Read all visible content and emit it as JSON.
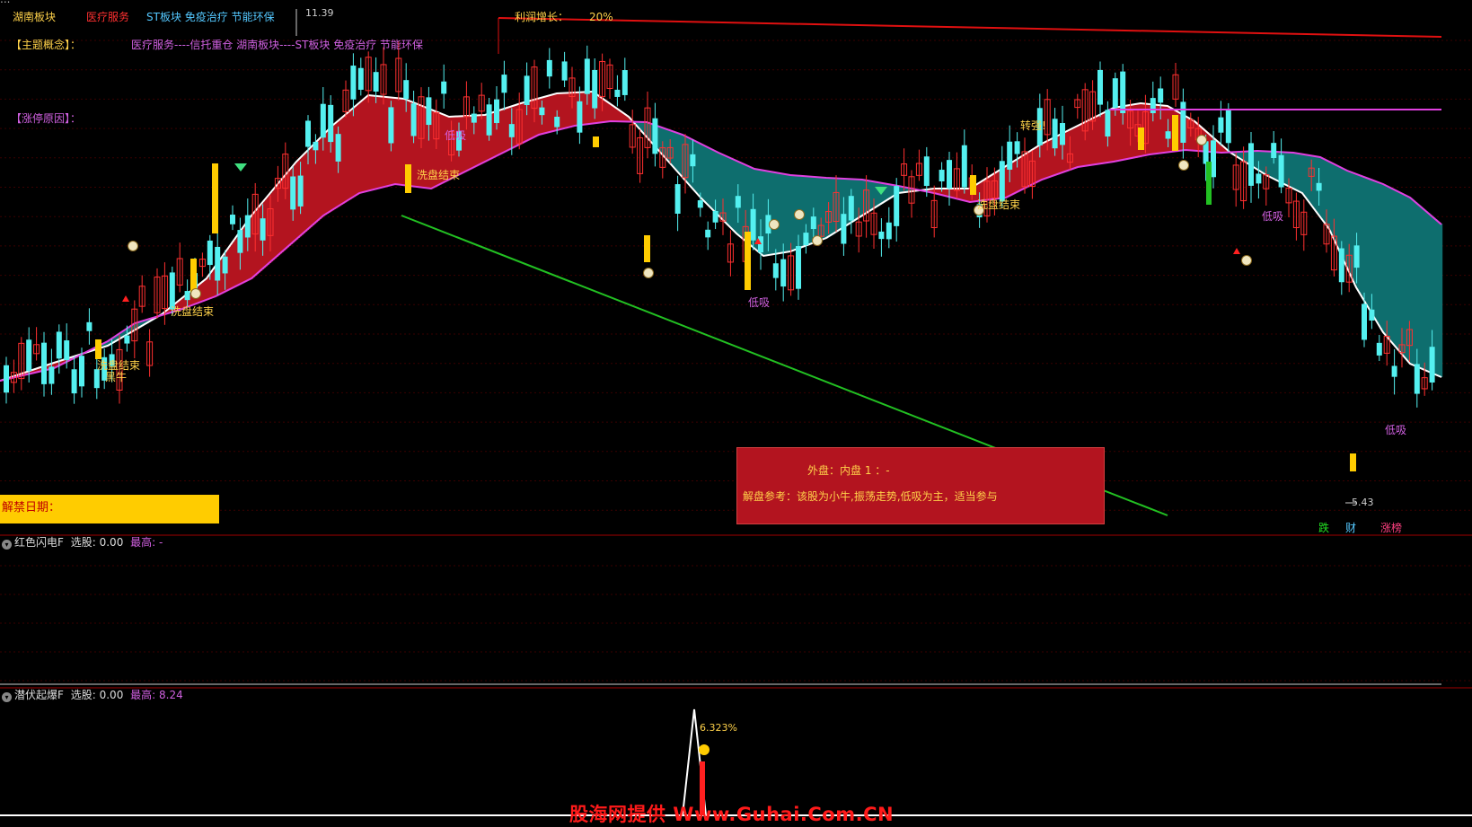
{
  "header": {
    "truncated_line": "...",
    "board": "湖南板块",
    "industry": "医疗服务",
    "concepts": "ST板块 免疫治疗 节能环保",
    "profit_growth_label": "利润增长：",
    "profit_growth_value": "20%",
    "theme_label": "【主题概念】：",
    "theme_value": "医疗服务----信托重仓 湖南板块----ST板块 免疫治疗 节能环保",
    "limit_reason_label": "【涨停原因】："
  },
  "main_chart": {
    "high_mark": "11.39",
    "low_mark": "5.43",
    "unlock_label": "解禁日期：",
    "signals": {
      "wash_end": "洗盘结束",
      "low_buy": "低吸",
      "black_horse": "黑牛",
      "turn_strong": "转强!",
      "wash_end_2": "洗盘结束"
    },
    "info_box": {
      "line1": "外盘：内盘   1  ：-",
      "line2": "解盘参考：该股为小牛,振荡走势,低吸为主，适当参与"
    },
    "tags": [
      "跌",
      "财",
      "涨榜"
    ],
    "colors": {
      "up": "#ff3030",
      "down": "#54f0f0",
      "band_up": "#b3141f",
      "band_down": "#0e6e6e",
      "trend": "#22c022"
    }
  },
  "pane2": {
    "name": "红色闪电F",
    "select_label": "选股:",
    "select_value": "0.00",
    "max_label": "最高:",
    "max_value": "-"
  },
  "pane3": {
    "name": "潜伏起爆F",
    "select_label": "选股:",
    "select_value": "0.00",
    "max_label": "最高:",
    "max_value": "8.24",
    "peak_label": "6.323%"
  },
  "watermark": "股海网提供 Www.Guhai.Com.CN"
}
